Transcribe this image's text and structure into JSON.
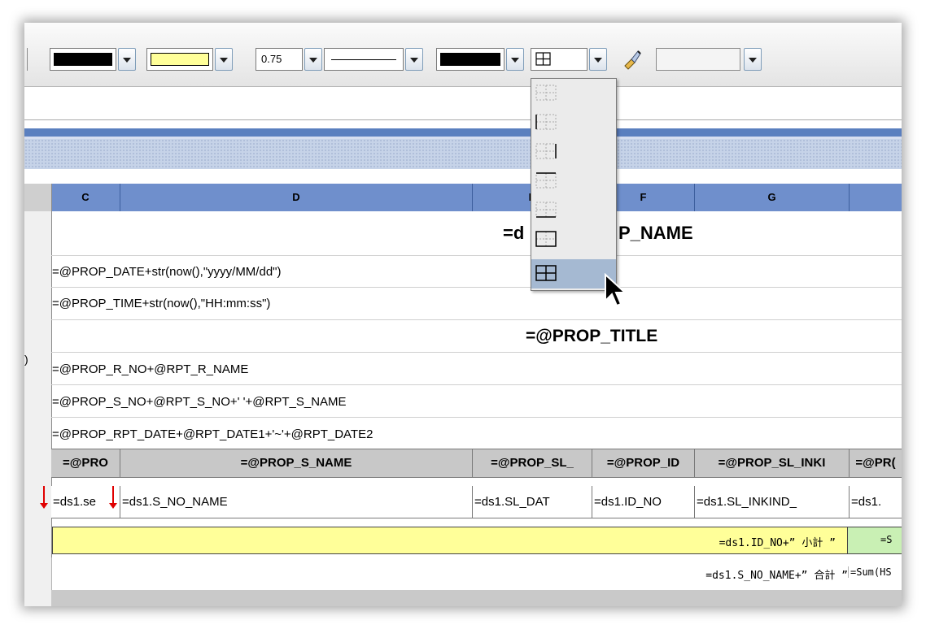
{
  "toolbar": {
    "border_width_value": "0.75",
    "line_color": "#000000",
    "fill_color": "#ffff99",
    "border_color": "#000000"
  },
  "columns": {
    "c": "C",
    "d": "D",
    "e": "E",
    "f": "F",
    "g": "G"
  },
  "sheet": {
    "title": "=ds1.PROP_NAME",
    "title_visible_left": "=d",
    "title_visible_right": "P_NAME",
    "date_row": "=@PROP_DATE+str(now(),\"yyyy/MM/dd\")",
    "time_row": "=@PROP_TIME+str(now(),\"HH:mm:ss\")",
    "report_title": "=@PROP_TITLE",
    "r_no_row": "=@PROP_R_NO+@RPT_R_NAME",
    "s_no_row": "=@PROP_S_NO+@RPT_S_NO+' '+@RPT_S_NAME",
    "rpt_date_row": "=@PROP_RPT_DATE+@RPT_DATE1+'~'+@RPT_DATE2"
  },
  "header_row": [
    "=@PRO",
    "=@PROP_S_NAME",
    "=@PROP_SL_",
    "=@PROP_ID",
    "=@PROP_SL_INKI",
    "=@PR("
  ],
  "data_row": [
    "=ds1.se",
    "=ds1.S_NO_NAME",
    "=ds1.SL_DAT",
    "=ds1.ID_NO",
    " =ds1.SL_INKIND_",
    " =ds1."
  ],
  "subtotal_row": {
    "label": "=ds1.ID_NO+” 小計 ”",
    "next": "=S"
  },
  "total_row": {
    "label": "=ds1.S_NO_NAME+” 合計 ”",
    "next": "=Sum(HS"
  },
  "left_edge_char": ")",
  "border_menu": {
    "items": [
      "no-border",
      "left-border",
      "right-border",
      "top-border",
      "bottom-border",
      "outer-border",
      "all-borders"
    ],
    "selected": "all-borders"
  }
}
